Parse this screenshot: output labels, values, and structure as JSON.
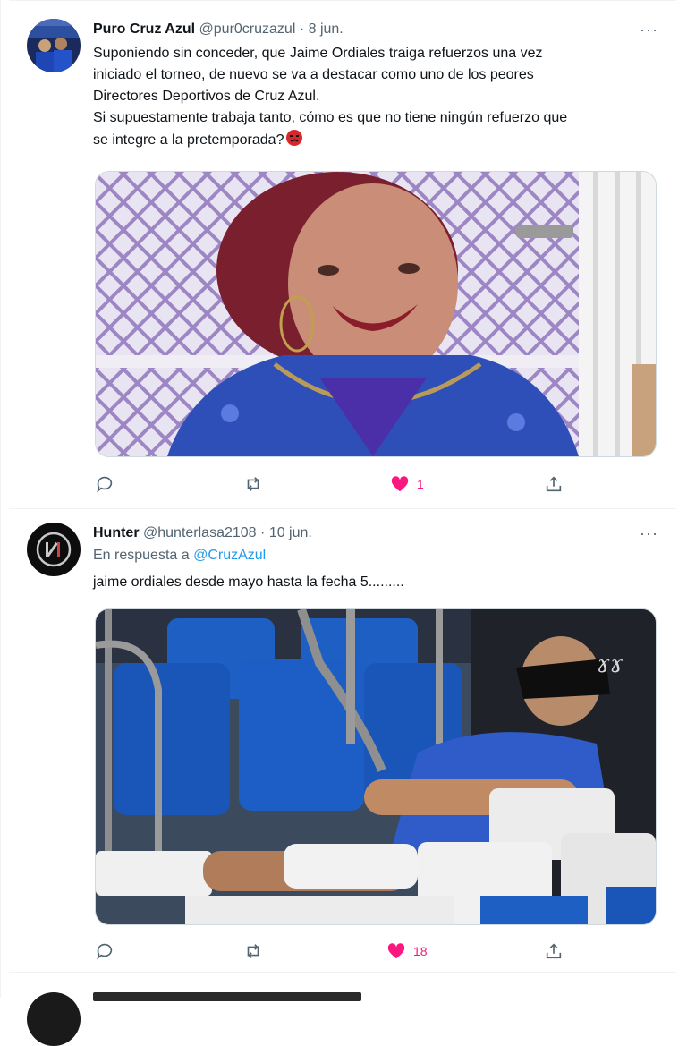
{
  "tweets": [
    {
      "name": "Puro Cruz Azul",
      "handle": "@pur0cruzazul",
      "separator": "·",
      "time": "8 jun.",
      "more": "···",
      "text_lines": [
        "Suponiendo sin conceder, que Jaime Ordiales traiga refuerzos una vez",
        "iniciado el torneo, de nuevo se va a destacar como uno de los peores",
        "Directores Deportivos de Cruz Azul.",
        "Si supuestamente trabaja tanto, cómo es que no tiene ningún refuerzo que",
        "se integre a la pretemporada?"
      ],
      "likes": "1"
    },
    {
      "name": "Hunter",
      "handle": "@hunterlasa2108",
      "separator": "·",
      "time": "10 jun.",
      "more": "···",
      "reply_prefix": "En respuesta a",
      "reply_mention": "@CruzAzul",
      "text_lines": [
        "jaime ordiales desde mayo hasta la fecha 5........."
      ],
      "likes": "18"
    }
  ],
  "icons": {
    "reply": "reply-icon",
    "retweet": "retweet-icon",
    "like": "heart-icon",
    "share": "share-icon",
    "angry": "angry-face-emoji"
  },
  "colors": {
    "text": "#0f1419",
    "secondary": "#536471",
    "link": "#1d9bf0",
    "like": "#f91880",
    "border": "#eff3f4"
  }
}
